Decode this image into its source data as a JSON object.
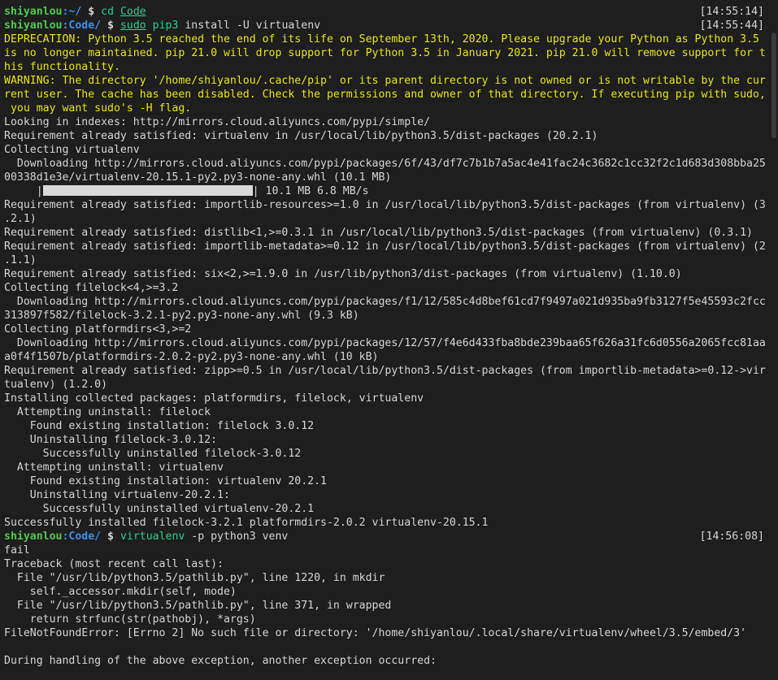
{
  "prompts": [
    {
      "user": "shiyanlou",
      "path": ":~/",
      "dollar": " $ ",
      "cmd": [
        {
          "text": "cd",
          "style": "green"
        },
        {
          "text": " ",
          "style": "plain"
        },
        {
          "text": "Code",
          "style": "under"
        }
      ],
      "timestamp": "[14:55:14]"
    },
    {
      "user": "shiyanlou",
      "path": ":Code/",
      "dollar": " $ ",
      "cmd": [
        {
          "text": "sudo",
          "style": "under"
        },
        {
          "text": " ",
          "style": "plain"
        },
        {
          "text": "pip3",
          "style": "green"
        },
        {
          "text": " install -U virtualenv",
          "style": "plain"
        }
      ],
      "timestamp": "[14:55:44]"
    },
    {
      "user": "shiyanlou",
      "path": ":Code/",
      "dollar": " $ ",
      "cmd": [
        {
          "text": "virtualenv",
          "style": "green"
        },
        {
          "text": " -p python3 venv",
          "style": "plain"
        }
      ],
      "timestamp": "[14:56:08]"
    }
  ],
  "output_block_1": [
    {
      "text": "DEPRECATION: Python 3.5 reached the end of its life on September 13th, 2020. Please upgrade your Python as Python 3.5",
      "style": "warn"
    },
    {
      "text": "is no longer maintained. pip 21.0 will drop support for Python 3.5 in January 2021. pip 21.0 will remove support for t",
      "style": "warn"
    },
    {
      "text": "his functionality.",
      "style": "warn"
    },
    {
      "text": "WARNING: The directory '/home/shiyanlou/.cache/pip' or its parent directory is not owned or is not writable by the cur",
      "style": "warn"
    },
    {
      "text": "rent user. The cache has been disabled. Check the permissions and owner of that directory. If executing pip with sudo,",
      "style": "warn"
    },
    {
      "text": " you may want sudo's -H flag.",
      "style": "warn"
    },
    {
      "text": "Looking in indexes: http://mirrors.cloud.aliyuncs.com/pypi/simple/",
      "style": "plain"
    },
    {
      "text": "Requirement already satisfied: virtualenv in /usr/local/lib/python3.5/dist-packages (20.2.1)",
      "style": "plain"
    },
    {
      "text": "Collecting virtualenv",
      "style": "plain"
    },
    {
      "text": "  Downloading http://mirrors.cloud.aliyuncs.com/pypi/packages/6f/43/df7c7b1b7a5ac4e41fac24c3682c1cc32f2c1d683d308bba25",
      "style": "plain"
    },
    {
      "text": "00338d1e3e/virtualenv-20.15.1-py2.py3-none-any.whl (10.1 MB)",
      "style": "plain"
    }
  ],
  "progress": {
    "prefix": "     |",
    "suffix": "| 10.1 MB 6.8 MB/s",
    "fill": 1.0
  },
  "output_block_2": [
    {
      "text": "Requirement already satisfied: importlib-resources>=1.0 in /usr/local/lib/python3.5/dist-packages (from virtualenv) (3",
      "style": "plain"
    },
    {
      "text": ".2.1)",
      "style": "plain"
    },
    {
      "text": "Requirement already satisfied: distlib<1,>=0.3.1 in /usr/local/lib/python3.5/dist-packages (from virtualenv) (0.3.1)",
      "style": "plain"
    },
    {
      "text": "Requirement already satisfied: importlib-metadata>=0.12 in /usr/local/lib/python3.5/dist-packages (from virtualenv) (2",
      "style": "plain"
    },
    {
      "text": ".1.1)",
      "style": "plain"
    },
    {
      "text": "Requirement already satisfied: six<2,>=1.9.0 in /usr/lib/python3/dist-packages (from virtualenv) (1.10.0)",
      "style": "plain"
    },
    {
      "text": "Collecting filelock<4,>=3.2",
      "style": "plain"
    },
    {
      "text": "  Downloading http://mirrors.cloud.aliyuncs.com/pypi/packages/f1/12/585c4d8bef61cd7f9497a021d935ba9fb3127f5e45593c2fcc",
      "style": "plain"
    },
    {
      "text": "313897f582/filelock-3.2.1-py2.py3-none-any.whl (9.3 kB)",
      "style": "plain"
    },
    {
      "text": "Collecting platformdirs<3,>=2",
      "style": "plain"
    },
    {
      "text": "  Downloading http://mirrors.cloud.aliyuncs.com/pypi/packages/12/57/f4e6d433fba8bde239baa65f626a31fc6d0556a2065fcc81aa",
      "style": "plain"
    },
    {
      "text": "a0f4f1507b/platformdirs-2.0.2-py2.py3-none-any.whl (10 kB)",
      "style": "plain"
    },
    {
      "text": "Requirement already satisfied: zipp>=0.5 in /usr/local/lib/python3.5/dist-packages (from importlib-metadata>=0.12->vir",
      "style": "plain"
    },
    {
      "text": "tualenv) (1.2.0)",
      "style": "plain"
    },
    {
      "text": "Installing collected packages: platformdirs, filelock, virtualenv",
      "style": "plain"
    },
    {
      "text": "  Attempting uninstall: filelock",
      "style": "plain"
    },
    {
      "text": "    Found existing installation: filelock 3.0.12",
      "style": "plain"
    },
    {
      "text": "    Uninstalling filelock-3.0.12:",
      "style": "plain"
    },
    {
      "text": "      Successfully uninstalled filelock-3.0.12",
      "style": "plain"
    },
    {
      "text": "  Attempting uninstall: virtualenv",
      "style": "plain"
    },
    {
      "text": "    Found existing installation: virtualenv 20.2.1",
      "style": "plain"
    },
    {
      "text": "    Uninstalling virtualenv-20.2.1:",
      "style": "plain"
    },
    {
      "text": "      Successfully uninstalled virtualenv-20.2.1",
      "style": "plain"
    },
    {
      "text": "Successfully installed filelock-3.2.1 platformdirs-2.0.2 virtualenv-20.15.1",
      "style": "plain"
    }
  ],
  "output_block_3": [
    {
      "text": "fail",
      "style": "plain"
    },
    {
      "text": "Traceback (most recent call last):",
      "style": "plain"
    },
    {
      "text": "  File \"/usr/lib/python3.5/pathlib.py\", line 1220, in mkdir",
      "style": "plain"
    },
    {
      "text": "    self._accessor.mkdir(self, mode)",
      "style": "plain"
    },
    {
      "text": "  File \"/usr/lib/python3.5/pathlib.py\", line 371, in wrapped",
      "style": "plain"
    },
    {
      "text": "    return strfunc(str(pathobj), *args)",
      "style": "plain"
    },
    {
      "text": "FileNotFoundError: [Errno 2] No such file or directory: '/home/shiyanlou/.local/share/virtualenv/wheel/3.5/embed/3'",
      "style": "plain"
    },
    {
      "text": "",
      "style": "plain"
    },
    {
      "text": "During handling of the above exception, another exception occurred:",
      "style": "plain"
    }
  ],
  "colors": {
    "background": "#1e1e1e",
    "text": "#d4d4d4",
    "user": "#4ec94e",
    "path": "#3b8eea",
    "command": "#23d18b",
    "warning": "#e5e510"
  }
}
